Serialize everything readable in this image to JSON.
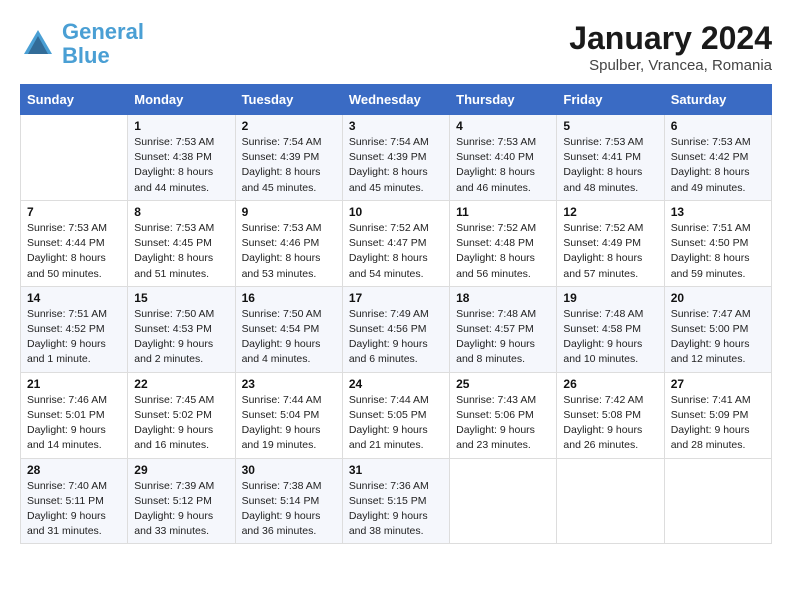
{
  "header": {
    "logo_line1": "General",
    "logo_line2": "Blue",
    "month": "January 2024",
    "location": "Spulber, Vrancea, Romania"
  },
  "columns": [
    "Sunday",
    "Monday",
    "Tuesday",
    "Wednesday",
    "Thursday",
    "Friday",
    "Saturday"
  ],
  "weeks": [
    [
      {
        "day": "",
        "info": ""
      },
      {
        "day": "1",
        "info": "Sunrise: 7:53 AM\nSunset: 4:38 PM\nDaylight: 8 hours\nand 44 minutes."
      },
      {
        "day": "2",
        "info": "Sunrise: 7:54 AM\nSunset: 4:39 PM\nDaylight: 8 hours\nand 45 minutes."
      },
      {
        "day": "3",
        "info": "Sunrise: 7:54 AM\nSunset: 4:39 PM\nDaylight: 8 hours\nand 45 minutes."
      },
      {
        "day": "4",
        "info": "Sunrise: 7:53 AM\nSunset: 4:40 PM\nDaylight: 8 hours\nand 46 minutes."
      },
      {
        "day": "5",
        "info": "Sunrise: 7:53 AM\nSunset: 4:41 PM\nDaylight: 8 hours\nand 48 minutes."
      },
      {
        "day": "6",
        "info": "Sunrise: 7:53 AM\nSunset: 4:42 PM\nDaylight: 8 hours\nand 49 minutes."
      }
    ],
    [
      {
        "day": "7",
        "info": "Sunrise: 7:53 AM\nSunset: 4:44 PM\nDaylight: 8 hours\nand 50 minutes."
      },
      {
        "day": "8",
        "info": "Sunrise: 7:53 AM\nSunset: 4:45 PM\nDaylight: 8 hours\nand 51 minutes."
      },
      {
        "day": "9",
        "info": "Sunrise: 7:53 AM\nSunset: 4:46 PM\nDaylight: 8 hours\nand 53 minutes."
      },
      {
        "day": "10",
        "info": "Sunrise: 7:52 AM\nSunset: 4:47 PM\nDaylight: 8 hours\nand 54 minutes."
      },
      {
        "day": "11",
        "info": "Sunrise: 7:52 AM\nSunset: 4:48 PM\nDaylight: 8 hours\nand 56 minutes."
      },
      {
        "day": "12",
        "info": "Sunrise: 7:52 AM\nSunset: 4:49 PM\nDaylight: 8 hours\nand 57 minutes."
      },
      {
        "day": "13",
        "info": "Sunrise: 7:51 AM\nSunset: 4:50 PM\nDaylight: 8 hours\nand 59 minutes."
      }
    ],
    [
      {
        "day": "14",
        "info": "Sunrise: 7:51 AM\nSunset: 4:52 PM\nDaylight: 9 hours\nand 1 minute."
      },
      {
        "day": "15",
        "info": "Sunrise: 7:50 AM\nSunset: 4:53 PM\nDaylight: 9 hours\nand 2 minutes."
      },
      {
        "day": "16",
        "info": "Sunrise: 7:50 AM\nSunset: 4:54 PM\nDaylight: 9 hours\nand 4 minutes."
      },
      {
        "day": "17",
        "info": "Sunrise: 7:49 AM\nSunset: 4:56 PM\nDaylight: 9 hours\nand 6 minutes."
      },
      {
        "day": "18",
        "info": "Sunrise: 7:48 AM\nSunset: 4:57 PM\nDaylight: 9 hours\nand 8 minutes."
      },
      {
        "day": "19",
        "info": "Sunrise: 7:48 AM\nSunset: 4:58 PM\nDaylight: 9 hours\nand 10 minutes."
      },
      {
        "day": "20",
        "info": "Sunrise: 7:47 AM\nSunset: 5:00 PM\nDaylight: 9 hours\nand 12 minutes."
      }
    ],
    [
      {
        "day": "21",
        "info": "Sunrise: 7:46 AM\nSunset: 5:01 PM\nDaylight: 9 hours\nand 14 minutes."
      },
      {
        "day": "22",
        "info": "Sunrise: 7:45 AM\nSunset: 5:02 PM\nDaylight: 9 hours\nand 16 minutes."
      },
      {
        "day": "23",
        "info": "Sunrise: 7:44 AM\nSunset: 5:04 PM\nDaylight: 9 hours\nand 19 minutes."
      },
      {
        "day": "24",
        "info": "Sunrise: 7:44 AM\nSunset: 5:05 PM\nDaylight: 9 hours\nand 21 minutes."
      },
      {
        "day": "25",
        "info": "Sunrise: 7:43 AM\nSunset: 5:06 PM\nDaylight: 9 hours\nand 23 minutes."
      },
      {
        "day": "26",
        "info": "Sunrise: 7:42 AM\nSunset: 5:08 PM\nDaylight: 9 hours\nand 26 minutes."
      },
      {
        "day": "27",
        "info": "Sunrise: 7:41 AM\nSunset: 5:09 PM\nDaylight: 9 hours\nand 28 minutes."
      }
    ],
    [
      {
        "day": "28",
        "info": "Sunrise: 7:40 AM\nSunset: 5:11 PM\nDaylight: 9 hours\nand 31 minutes."
      },
      {
        "day": "29",
        "info": "Sunrise: 7:39 AM\nSunset: 5:12 PM\nDaylight: 9 hours\nand 33 minutes."
      },
      {
        "day": "30",
        "info": "Sunrise: 7:38 AM\nSunset: 5:14 PM\nDaylight: 9 hours\nand 36 minutes."
      },
      {
        "day": "31",
        "info": "Sunrise: 7:36 AM\nSunset: 5:15 PM\nDaylight: 9 hours\nand 38 minutes."
      },
      {
        "day": "",
        "info": ""
      },
      {
        "day": "",
        "info": ""
      },
      {
        "day": "",
        "info": ""
      }
    ]
  ]
}
